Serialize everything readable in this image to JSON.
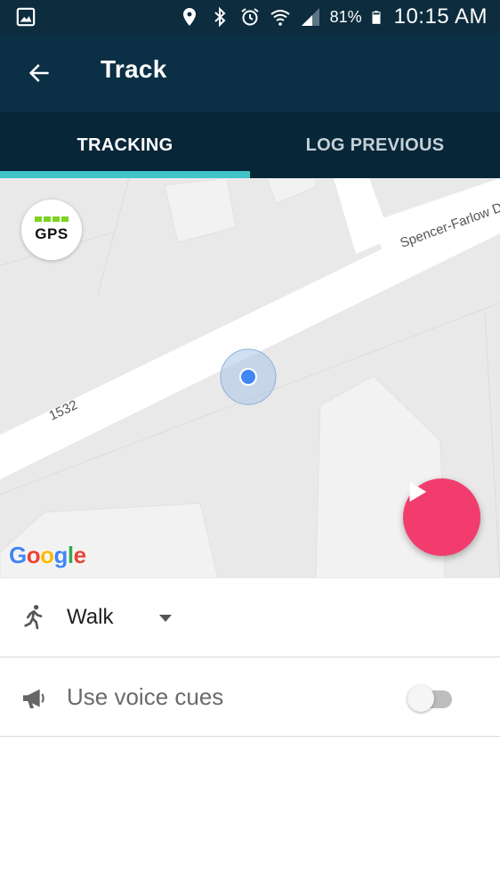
{
  "status_bar": {
    "battery_percent": "81%",
    "time": "10:15 AM",
    "icons": [
      "image-icon",
      "location-icon",
      "bluetooth-icon",
      "alarm-icon",
      "wifi-icon",
      "signal-icon",
      "battery-icon"
    ]
  },
  "app_bar": {
    "title": "Track"
  },
  "tabs": [
    {
      "label": "TRACKING",
      "active": true
    },
    {
      "label": "LOG PREVIOUS",
      "active": false
    }
  ],
  "map": {
    "gps_label": "GPS",
    "street_label_1": "Spencer-Farlow D",
    "street_label_2": "1532",
    "google_logo": [
      "G",
      "o",
      "o",
      "g",
      "l",
      "e"
    ],
    "colors": {
      "road": "#ffffff",
      "land": "#e9e9e9",
      "location_dot": "#4285f4",
      "accuracy_ring": "#a9c4e8",
      "gps_signal": "#7ed321"
    }
  },
  "play_button": {
    "icon": "play-icon",
    "color": "#f23c6e"
  },
  "activity": {
    "icon": "walk-icon",
    "label": "Walk"
  },
  "voice_cues": {
    "icon": "megaphone-icon",
    "label": "Use voice cues",
    "enabled": false
  },
  "colors": {
    "status_bar": "#0d2c3e",
    "app_bar": "#0b2f44",
    "tab_bar": "#072637",
    "tab_indicator": "#40c4c8"
  }
}
